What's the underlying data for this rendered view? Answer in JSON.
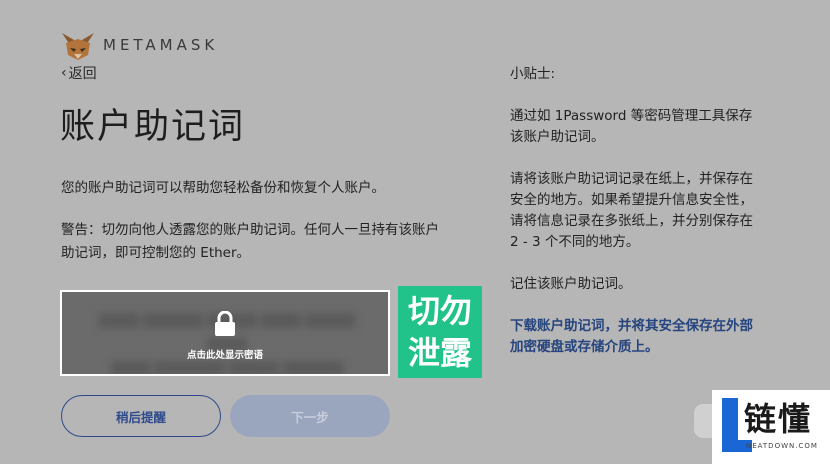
{
  "header": {
    "brand": "METAMASK",
    "back_label": "返回"
  },
  "main": {
    "title": "账户助记词",
    "description": "您的账户助记词可以帮助您轻松备份和恢复个人账户。",
    "warning": "警告：切勿向他人透露您的账户助记词。任何人一旦持有该账户助记词，即可控制您的 Ether。"
  },
  "secret": {
    "reveal_hint": "点击此处显示密语",
    "stamp_line1": "切勿",
    "stamp_line2": "泄露"
  },
  "buttons": {
    "remind_later": "稍后提醒",
    "next": "下一步"
  },
  "tips": {
    "heading": "小贴士:",
    "p1": "通过如 1Password 等密码管理工具保存该账户助记词。",
    "p2": "请将该账户助记词记录在纸上，并保存在安全的地方。如果希望提升信息安全性，请将信息记录在多张纸上，并分别保存在 2 - 3 个不同的地方。",
    "p3": "记住该账户助记词。",
    "download_link": "下载账户助记词，并将其安全保存在外部加密硬盘或存储介质上。"
  },
  "watermark": {
    "badge_cn": "链懂",
    "badge_en": "NEATDOWN.COM"
  },
  "colors": {
    "accent": "#2f4b8c",
    "stamp": "#22c38a",
    "link": "#26457e"
  }
}
